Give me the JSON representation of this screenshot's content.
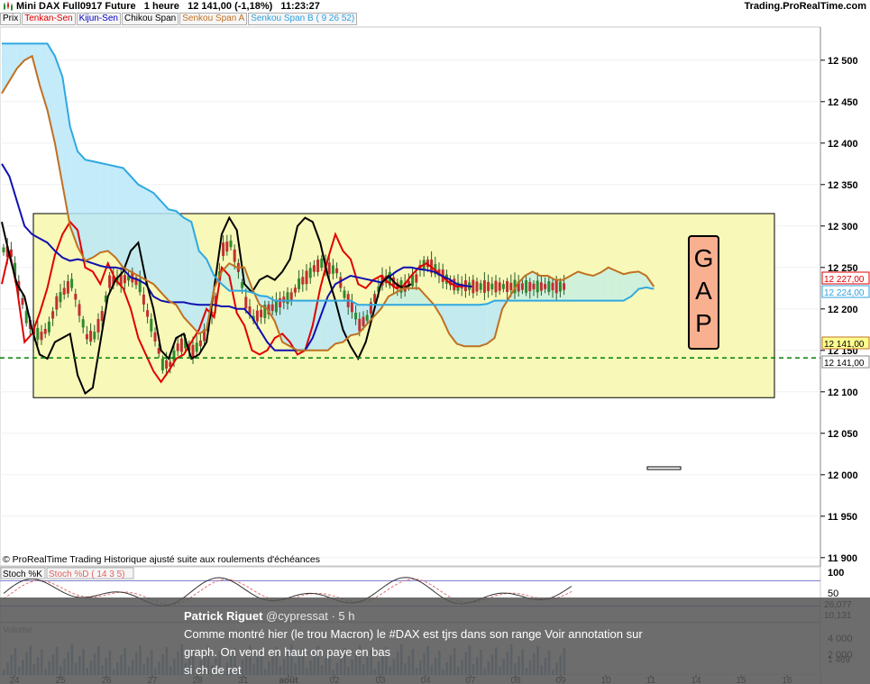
{
  "window": {
    "title": "Mini DAX Full0917 Future   1 heure   12 141,00 (-1,18%)   11:23:27",
    "brand": "Trading.ProRealTime.com"
  },
  "legend": {
    "items": [
      "Prix",
      "Tenkan-Sen",
      "Kijun-Sen",
      "Chikou Span",
      "Senkou Span A",
      "Senkou Span B ( 9 26 52)"
    ],
    "colors": [
      "#000000",
      "#e00000",
      "#0000c0",
      "#000000",
      "#c07020",
      "#30a0e0"
    ]
  },
  "footer_note": "© ProRealTime Trading  Historique ajusté suite aux roulements d'échéances",
  "annotation": {
    "letters": [
      "G",
      "A",
      "P"
    ],
    "fill": "#f8b090"
  },
  "price_badges": [
    "12 227,00",
    "12 224,00",
    "12 141,00",
    "12 141,00"
  ],
  "stoch_panel": {
    "labels": [
      "Stoch %K",
      "Stoch %D ( 14 3 5)"
    ],
    "axis": [
      "100",
      "50",
      "20"
    ],
    "values": [
      "26,077",
      "10,131"
    ],
    "levels": [
      80,
      20
    ]
  },
  "volume_panel": {
    "label": "Volume",
    "axis": [
      "4 000",
      "2 000"
    ],
    "value": "1 469"
  },
  "tweet": {
    "author": "Patrick Riguet",
    "handle": "@cypressat · 5 h",
    "lines": [
      "Comme montré hier (le trou Macron) le #DAX est tjrs dans son range Voir annotation sur",
      "graph. On vend en haut on paye en bas",
      "si ch de ret"
    ]
  },
  "colors": {
    "tenkan": "#e00000",
    "kijun": "#1010b0",
    "chikou": "#000000",
    "spanA": "#c07020",
    "spanB": "#30a8e0",
    "cloud_bull": "#c8f0e0",
    "cloud_bear": "#b8e8f8",
    "range_box": "#f8f8b8",
    "candle_up": "#2e8b2e",
    "candle_down": "#c03030",
    "last_price_line": "#008000"
  },
  "chart_data": {
    "type": "candlestick",
    "title": "Mini DAX Full0917 Future   1 heure",
    "xlabel": "",
    "ylabel": "",
    "ylim": [
      11890,
      12540
    ],
    "y_ticks": [
      12500,
      12450,
      12400,
      12350,
      12300,
      12250,
      12200,
      12150,
      12100,
      12050,
      12000,
      11950,
      11900
    ],
    "y_tick_labels": [
      "12 500",
      "12 450",
      "12 400",
      "12 350",
      "12 300",
      "12 250",
      "12 200",
      "12 150",
      "12 100",
      "12 050",
      "12 000",
      "11 950",
      "11 900"
    ],
    "x_tick_labels": [
      "24",
      "25",
      "26",
      "27",
      "28",
      "31",
      "août",
      "02",
      "03",
      "04",
      "07",
      "08",
      "09",
      "10",
      "11",
      "14",
      "15",
      "16"
    ],
    "range_box": {
      "y_top": 12315,
      "y_bottom": 12093
    },
    "last_price": 12141,
    "series": [
      {
        "name": "Tenkan-Sen",
        "x": [
          0,
          2,
          4,
          6,
          8,
          10,
          12,
          14,
          16,
          18,
          20,
          22,
          24,
          26,
          28,
          30,
          32,
          34,
          36,
          38,
          40,
          42,
          44,
          46,
          48,
          50,
          52,
          54,
          56,
          58,
          60,
          62,
          64,
          66,
          68,
          70,
          72,
          74,
          76,
          78,
          80,
          82,
          84,
          86,
          88,
          90,
          92,
          94,
          96,
          98,
          100,
          102,
          104,
          106,
          108,
          110,
          112,
          114,
          116,
          118,
          120,
          122,
          124
        ],
        "y": [
          12230,
          12270,
          12225,
          12160,
          12170,
          12195,
          12225,
          12265,
          12290,
          12305,
          12295,
          12250,
          12245,
          12230,
          12255,
          12235,
          12225,
          12200,
          12165,
          12145,
          12125,
          12112,
          12125,
          12140,
          12145,
          12160,
          12175,
          12200,
          12190,
          12250,
          12240,
          12195,
          12180,
          12150,
          12145,
          12150,
          12165,
          12170,
          12160,
          12145,
          12150,
          12180,
          12225,
          12260,
          12290,
          12270,
          12260,
          12230,
          12225,
          12235,
          12240,
          12232,
          12225,
          12228,
          12240,
          12250,
          12255,
          12248,
          12240,
          12232,
          12227,
          12228,
          12227
        ]
      },
      {
        "name": "Kijun-Sen",
        "x": [
          0,
          2,
          4,
          6,
          8,
          10,
          12,
          14,
          16,
          18,
          20,
          22,
          24,
          26,
          28,
          30,
          32,
          34,
          36,
          38,
          40,
          42,
          44,
          46,
          48,
          50,
          52,
          54,
          56,
          58,
          60,
          62,
          64,
          66,
          68,
          70,
          72,
          74,
          76,
          78,
          80,
          82,
          84,
          86,
          88,
          90,
          92,
          94,
          96,
          98,
          100,
          102,
          104,
          106,
          108,
          110,
          112,
          114,
          116,
          118,
          120,
          122,
          124
        ],
        "y": [
          12375,
          12360,
          12330,
          12300,
          12290,
          12285,
          12280,
          12270,
          12262,
          12258,
          12260,
          12258,
          12255,
          12252,
          12250,
          12250,
          12248,
          12238,
          12235,
          12230,
          12215,
          12210,
          12208,
          12208,
          12208,
          12206,
          12205,
          12205,
          12205,
          12203,
          12203,
          12200,
          12200,
          12190,
          12175,
          12160,
          12150,
          12150,
          12150,
          12150,
          12150,
          12165,
          12190,
          12215,
          12230,
          12235,
          12240,
          12238,
          12236,
          12234,
          12232,
          12238,
          12245,
          12250,
          12250,
          12248,
          12247,
          12245,
          12240,
          12236,
          12230,
          12228,
          12227
        ]
      },
      {
        "name": "Chikou Span",
        "x": [
          0,
          2,
          4,
          6,
          8,
          10,
          12,
          14,
          16,
          18,
          20,
          22,
          24,
          26,
          28,
          30,
          32,
          34,
          36,
          38,
          40,
          42,
          44,
          46,
          48,
          50,
          52,
          54,
          56,
          58,
          60,
          62,
          64,
          66,
          68,
          70,
          72,
          74,
          76,
          78,
          80,
          82,
          84,
          86,
          88,
          90,
          92,
          94,
          96,
          98,
          100,
          102,
          104,
          106,
          108
        ],
        "y": [
          12305,
          12265,
          12230,
          12215,
          12175,
          12145,
          12140,
          12160,
          12165,
          12170,
          12120,
          12098,
          12105,
          12160,
          12215,
          12235,
          12245,
          12270,
          12280,
          12235,
          12200,
          12150,
          12140,
          12165,
          12170,
          12140,
          12145,
          12160,
          12225,
          12290,
          12310,
          12295,
          12230,
          12220,
          12235,
          12240,
          12235,
          12245,
          12260,
          12300,
          12310,
          12305,
          12280,
          12240,
          12210,
          12175,
          12155,
          12140,
          12160,
          12195,
          12230,
          12240,
          12230,
          12225,
          12230
        ]
      },
      {
        "name": "Senkou Span A",
        "x": [
          0,
          2,
          4,
          6,
          8,
          10,
          12,
          14,
          16,
          18,
          20,
          22,
          24,
          26,
          28,
          30,
          32,
          34,
          36,
          38,
          40,
          42,
          44,
          46,
          48,
          50,
          52,
          54,
          56,
          58,
          60,
          62,
          64,
          66,
          68,
          70,
          72,
          74,
          76,
          78,
          80,
          82,
          84,
          86,
          88,
          90,
          92,
          94,
          96,
          98,
          100,
          102,
          104,
          106,
          108,
          110,
          112,
          114,
          116,
          118,
          120,
          122,
          124,
          126,
          128,
          130,
          132,
          134,
          136,
          138,
          140,
          142,
          144,
          146,
          148,
          150,
          152,
          154,
          156,
          158,
          160,
          162,
          164,
          166,
          168,
          170,
          172
        ],
        "y": [
          12460,
          12475,
          12490,
          12500,
          12505,
          12470,
          12440,
          12400,
          12350,
          12300,
          12275,
          12258,
          12262,
          12268,
          12270,
          12262,
          12250,
          12245,
          12240,
          12235,
          12230,
          12220,
          12210,
          12205,
          12190,
          12180,
          12170,
          12175,
          12225,
          12245,
          12255,
          12250,
          12250,
          12225,
          12205,
          12200,
          12185,
          12160,
          12155,
          12150,
          12150,
          12150,
          12150,
          12150,
          12158,
          12160,
          12168,
          12170,
          12180,
          12190,
          12200,
          12215,
          12220,
          12225,
          12225,
          12225,
          12215,
          12205,
          12190,
          12170,
          12158,
          12155,
          12155,
          12155,
          12158,
          12165,
          12200,
          12215,
          12230,
          12240,
          12245,
          12240,
          12240,
          12235,
          12235,
          12240,
          12245,
          12242,
          12240,
          12244,
          12250,
          12246,
          12242,
          12244,
          12245,
          12240,
          12227
        ]
      },
      {
        "name": "Senkou Span B",
        "x": [
          0,
          2,
          4,
          6,
          8,
          10,
          12,
          14,
          16,
          18,
          20,
          22,
          24,
          26,
          28,
          30,
          32,
          34,
          36,
          38,
          40,
          42,
          44,
          46,
          48,
          50,
          52,
          54,
          56,
          58,
          60,
          62,
          64,
          66,
          68,
          70,
          72,
          74,
          76,
          78,
          80,
          82,
          84,
          86,
          88,
          90,
          92,
          94,
          96,
          98,
          100,
          102,
          104,
          106,
          108,
          110,
          112,
          114,
          116,
          118,
          120,
          122,
          124,
          126,
          128,
          130,
          132,
          134,
          136,
          138,
          140,
          142,
          144,
          146,
          148,
          150,
          152,
          154,
          156,
          158,
          160,
          162,
          164,
          166,
          168,
          170,
          172
        ],
        "y": [
          12520,
          12520,
          12520,
          12520,
          12520,
          12520,
          12520,
          12505,
          12480,
          12420,
          12390,
          12380,
          12378,
          12376,
          12374,
          12372,
          12370,
          12360,
          12350,
          12345,
          12340,
          12330,
          12320,
          12318,
          12310,
          12305,
          12270,
          12260,
          12240,
          12230,
          12222,
          12222,
          12222,
          12220,
          12216,
          12215,
          12210,
          12210,
          12210,
          12210,
          12210,
          12210,
          12210,
          12210,
          12210,
          12210,
          12210,
          12205,
          12205,
          12205,
          12205,
          12205,
          12205,
          12205,
          12205,
          12205,
          12205,
          12205,
          12205,
          12205,
          12205,
          12205,
          12205,
          12205,
          12206,
          12210,
          12210,
          12210,
          12210,
          12210,
          12210,
          12210,
          12210,
          12210,
          12210,
          12210,
          12210,
          12210,
          12210,
          12210,
          12210,
          12210,
          12210,
          12215,
          12224,
          12226,
          12224
        ]
      }
    ]
  }
}
